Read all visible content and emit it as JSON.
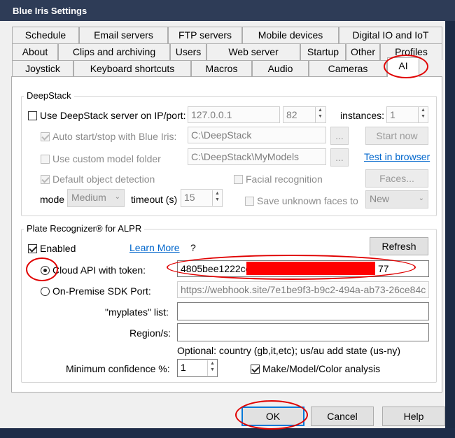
{
  "window": {
    "title": "Blue Iris Settings"
  },
  "tabs": {
    "row1": [
      "Schedule",
      "Email servers",
      "FTP servers",
      "Mobile devices",
      "Digital IO and IoT"
    ],
    "row2": [
      "About",
      "Clips and archiving",
      "Users",
      "Web server",
      "Startup",
      "Other",
      "Profiles"
    ],
    "row3": [
      "Joystick",
      "Keyboard shortcuts",
      "Macros",
      "Audio",
      "Cameras",
      "AI"
    ]
  },
  "deepstack": {
    "title": "DeepStack",
    "use_server_label": "Use DeepStack server on IP/port:",
    "ip": "127.0.0.1",
    "port": "82",
    "instances_label": "instances:",
    "instances": "1",
    "auto_start_label": "Auto start/stop with Blue Iris:",
    "path": "C:\\DeepStack",
    "browse": "...",
    "start_now": "Start now",
    "custom_model_label": "Use custom model folder",
    "model_path": "C:\\DeepStack\\MyModels",
    "browse2": "...",
    "test_browser": "Test in browser",
    "default_detection_label": "Default object detection",
    "facial_label": "Facial recognition",
    "faces_btn": "Faces...",
    "mode_label": "mode",
    "mode_value": "Medium",
    "timeout_label": "timeout (s)",
    "timeout_value": "15",
    "save_unknown_label": "Save unknown faces to",
    "save_unknown_value": "New"
  },
  "plate": {
    "title": "Plate Recognizer® for ALPR",
    "enabled_label": "Enabled",
    "learn_more": "Learn More",
    "question": "?",
    "refresh": "Refresh",
    "cloud_label": "Cloud API with token:",
    "token_start": "4805bee1222ce",
    "token_end": "77",
    "onprem_label": "On-Premise SDK Port:",
    "onprem_value": "https://webhook.site/7e1be9f3-b9c2-494a-ab73-26ce84c",
    "myplates_label": "\"myplates\" list:",
    "myplates_value": "",
    "region_label": "Region/s:",
    "region_value": "",
    "region_hint": "Optional: country (gb,it,etc); us/au add state (us-ny)",
    "min_conf_label": "Minimum confidence %:",
    "min_conf_value": "1",
    "mmc_label": "Make/Model/Color analysis"
  },
  "buttons": {
    "ok": "OK",
    "cancel": "Cancel",
    "help": "Help"
  },
  "colors": {
    "annotation": "#e00000",
    "link": "#0066cc"
  }
}
